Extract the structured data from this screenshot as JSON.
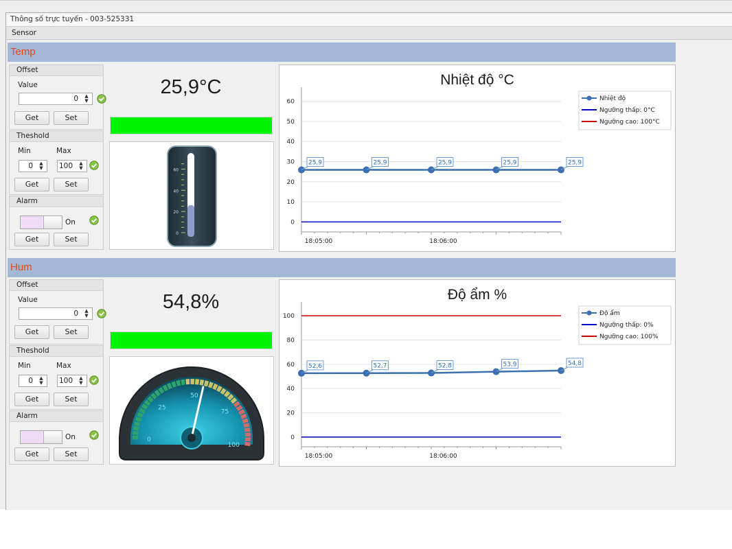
{
  "window": {
    "title": "Thông số trực tuyến - 003-525331",
    "menu": "Sensor"
  },
  "colors": {
    "header_bg": "#a3b7d6",
    "header_text": "#e34a17",
    "status_bar": "#00f300",
    "series_blue": "#3b6fb0",
    "low_line": "#0000c8",
    "high_line": "#c80000"
  },
  "temp": {
    "header": "Temp",
    "offset": {
      "title": "Offset",
      "value_label": "Value",
      "value": "0",
      "get": "Get",
      "set": "Set"
    },
    "threshold": {
      "title": "Theshold",
      "min_label": "Min",
      "max_label": "Max",
      "min": "0",
      "max": "100",
      "get": "Get",
      "set": "Set"
    },
    "alarm": {
      "title": "Alarm",
      "state": "On",
      "get": "Get",
      "set": "Set"
    },
    "reading": "25,9°C",
    "gauge": {
      "type": "linear-thermometer",
      "ticks": [
        "60",
        "40",
        "20",
        "0"
      ],
      "level": 25.9
    }
  },
  "hum": {
    "header": "Hum",
    "offset": {
      "title": "Offset",
      "value_label": "Value",
      "value": "0",
      "get": "Get",
      "set": "Set"
    },
    "threshold": {
      "title": "Theshold",
      "min_label": "Min",
      "max_label": "Max",
      "min": "0",
      "max": "100",
      "get": "Get",
      "set": "Set"
    },
    "alarm": {
      "title": "Alarm",
      "state": "On",
      "get": "Get",
      "set": "Set"
    },
    "reading": "54,8%",
    "gauge": {
      "type": "circular-speedometer",
      "ticks": [
        "0",
        "25",
        "50",
        "75",
        "100"
      ],
      "level": 54.8
    }
  },
  "chart_data": [
    {
      "type": "line",
      "title": "Nhiệt độ °C",
      "x_ticks": [
        "18:05:00",
        "18:06:00"
      ],
      "ylim": [
        -5,
        65
      ],
      "y_ticks": [
        0,
        10,
        20,
        30,
        40,
        50,
        60
      ],
      "grid": true,
      "legend_position": "top-right",
      "series": [
        {
          "name": "Nhiệt độ",
          "values": [
            25.9,
            25.9,
            25.9,
            25.9,
            25.9
          ],
          "labels": [
            "25,9",
            "",
            "25,9",
            "25,9",
            "25,9"
          ],
          "extra_labels": [
            "25,9"
          ]
        },
        {
          "name": "Ngưỡng thấp: 0°C",
          "values": [
            0,
            0,
            0,
            0,
            0
          ]
        },
        {
          "name": "Ngưỡng cao: 100°C",
          "values": [
            100,
            100,
            100,
            100,
            100
          ]
        }
      ]
    },
    {
      "type": "line",
      "title": "Độ ẩm %",
      "x_ticks": [
        "18:05:00",
        "18:06:00"
      ],
      "ylim": [
        -8,
        108
      ],
      "y_ticks": [
        0,
        20,
        40,
        60,
        80,
        100
      ],
      "grid": true,
      "legend_position": "top-right",
      "series": [
        {
          "name": "Độ ẩm",
          "values": [
            52.6,
            52.7,
            52.8,
            53.9,
            54.8
          ],
          "labels": [
            "52,6",
            "52,7",
            "52,8",
            "53,9",
            "54,8"
          ]
        },
        {
          "name": "Ngưỡng thấp: 0%",
          "values": [
            0,
            0,
            0,
            0,
            0
          ]
        },
        {
          "name": "Ngưỡng cao: 100%",
          "values": [
            100,
            100,
            100,
            100,
            100
          ]
        }
      ]
    }
  ]
}
